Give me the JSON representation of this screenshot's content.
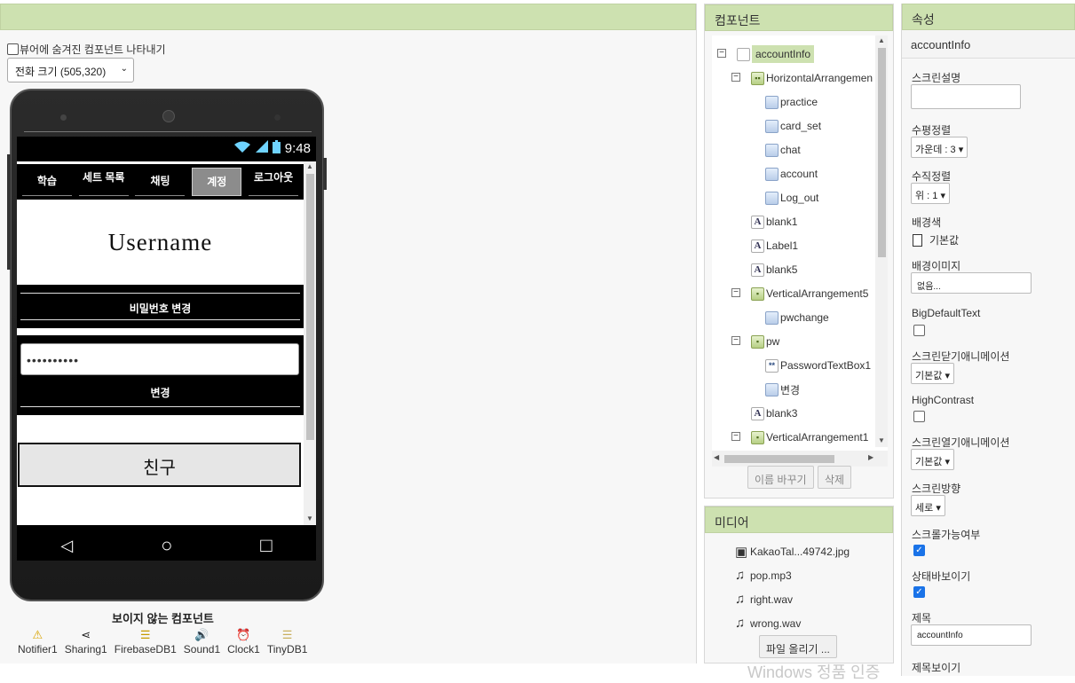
{
  "viewer": {
    "show_hidden_label": "뷰어에 숨겨진 컴포넌트 나타내기",
    "size_select": "전화 크기 (505,320)",
    "status_time": "9:48",
    "tabs": [
      "학습",
      "세트 목록",
      "채팅",
      "계정",
      "로그아웃"
    ],
    "active_tab": "계정",
    "username": "Username",
    "pw_change_header": "비밀번호 변경",
    "pw_value": "••••••••••",
    "change_button": "변경",
    "friend_button": "친구",
    "nav_back": "◁",
    "nav_home": "○",
    "nav_recent": "□",
    "invisible_label": "보이지 않는 컴포넌트",
    "nonvisible": [
      {
        "icon": "warning-icon",
        "glyph": "⚠",
        "label": "Notifier1"
      },
      {
        "icon": "share-icon",
        "glyph": "⋖",
        "label": "Sharing1"
      },
      {
        "icon": "database-icon",
        "glyph": "☰",
        "label": "FirebaseDB1"
      },
      {
        "icon": "speaker-icon",
        "glyph": "🔊",
        "label": "Sound1"
      },
      {
        "icon": "clock-icon",
        "glyph": "⏰",
        "label": "Clock1"
      },
      {
        "icon": "database-icon",
        "glyph": "☰",
        "label": "TinyDB1"
      }
    ]
  },
  "components": {
    "header": "컴포넌트",
    "tree": [
      {
        "label": "accountInfo",
        "icon": "screen-icon",
        "toggle": "⊟"
      },
      {
        "label": "HorizontalArrangemen",
        "icon": "horizontal-arrangement-icon",
        "toggle": "⊟"
      },
      {
        "label": "practice",
        "icon": "button-icon"
      },
      {
        "label": "card_set",
        "icon": "button-icon"
      },
      {
        "label": "chat",
        "icon": "button-icon"
      },
      {
        "label": "account",
        "icon": "button-icon"
      },
      {
        "label": "Log_out",
        "icon": "button-icon"
      },
      {
        "label": "blank1",
        "icon": "label-icon"
      },
      {
        "label": "Label1",
        "icon": "label-icon"
      },
      {
        "label": "blank5",
        "icon": "label-icon"
      },
      {
        "label": "VerticalArrangement5",
        "icon": "vertical-arrangement-icon",
        "toggle": "⊟"
      },
      {
        "label": "pwchange",
        "icon": "button-icon"
      },
      {
        "label": "pw",
        "icon": "vertical-arrangement-icon",
        "toggle": "⊟"
      },
      {
        "label": "PasswordTextBox1",
        "icon": "password-icon"
      },
      {
        "label": "변경",
        "icon": "button-icon"
      },
      {
        "label": "blank3",
        "icon": "label-icon"
      },
      {
        "label": "VerticalArrangement1",
        "icon": "vertical-arrangement-icon",
        "toggle": "⊟"
      }
    ],
    "rename_button": "이름 바꾸기",
    "delete_button": "삭제"
  },
  "media": {
    "header": "미디어",
    "files": [
      {
        "name": "KakaoTal...49742.jpg",
        "icon": "image-icon"
      },
      {
        "name": "pop.mp3",
        "icon": "music-icon"
      },
      {
        "name": "right.wav",
        "icon": "music-icon"
      },
      {
        "name": "wrong.wav",
        "icon": "music-icon"
      }
    ],
    "upload_button": "파일 올리기 ..."
  },
  "properties": {
    "header": "속성",
    "component": "accountInfo",
    "screen_desc_label": "스크린설명",
    "halign_label": "수평정렬",
    "halign_value": "가운데 : 3",
    "valign_label": "수직정렬",
    "valign_value": "위 : 1",
    "bgcolor_label": "배경색",
    "bgcolor_value": "기본값",
    "bgimage_label": "배경이미지",
    "bgimage_value": "없음...",
    "bigtext_label": "BigDefaultText",
    "close_anim_label": "스크린닫기애니메이션",
    "close_anim_value": "기본값",
    "highcontrast_label": "HighContrast",
    "open_anim_label": "스크린열기애니메이션",
    "open_anim_value": "기본값",
    "orientation_label": "스크린방향",
    "orientation_value": "세로",
    "scrollable_label": "스크롤가능여부",
    "statusbar_label": "상태바보이기",
    "title_label": "제목",
    "title_value": "accountInfo",
    "titlevisible_label": "제목보이기"
  },
  "watermark": "Windows 정품 인증"
}
